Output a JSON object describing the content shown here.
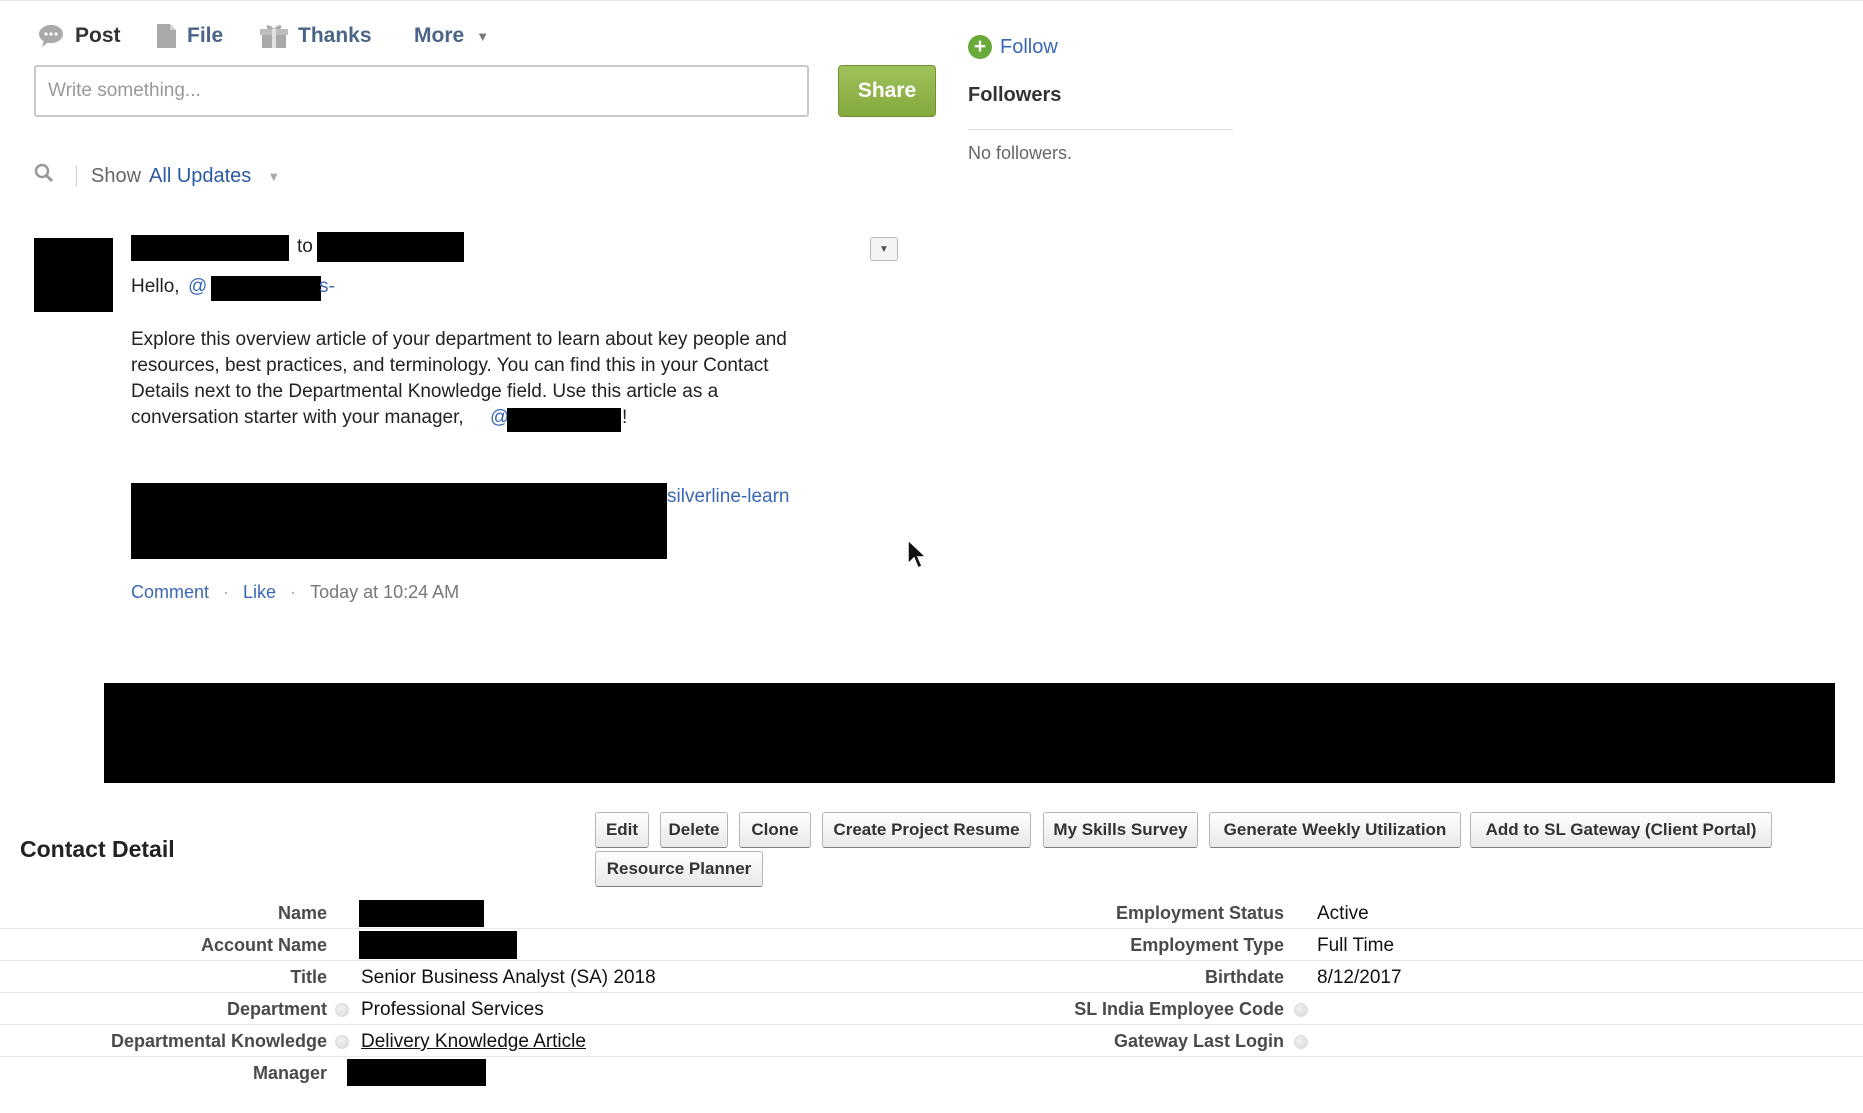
{
  "publisher": {
    "tabs": [
      {
        "label": "Post",
        "icon": "speech-bubble-icon"
      },
      {
        "label": "File",
        "icon": "file-icon"
      },
      {
        "label": "Thanks",
        "icon": "gift-icon"
      },
      {
        "label": "More",
        "icon": "chevron-down-icon"
      }
    ],
    "compose_placeholder": "Write something...",
    "share_label": "Share"
  },
  "filter": {
    "show_label": "Show",
    "selected": "All Updates"
  },
  "feed_item": {
    "to_word": "to",
    "greeting": "Hello,",
    "mention_prefix": "@",
    "mention_suffix": "s-",
    "body": "Explore this overview article of your department to learn about key people and resources, best practices, and terminology. You can find this in your Contact Details next to the Departmental Knowledge field. Use this article as a conversation starter with your manager,",
    "manager_mention_prefix": "@",
    "exclaim": "!",
    "link_text": "silverline-learn",
    "actions": {
      "comment": "Comment",
      "like": "Like",
      "time": "Today at 10:24 AM"
    }
  },
  "follow_panel": {
    "follow_label": "Follow",
    "followers_heading": "Followers",
    "no_followers": "No followers."
  },
  "contact_detail": {
    "title": "Contact Detail",
    "buttons": {
      "edit": "Edit",
      "delete": "Delete",
      "clone": "Clone",
      "create_resume": "Create Project Resume",
      "skills_survey": "My Skills Survey",
      "weekly_util": "Generate Weekly Utilization",
      "gateway": "Add to SL Gateway (Client Portal)",
      "resource_planner": "Resource Planner"
    },
    "left_fields": {
      "name": {
        "label": "Name",
        "value": ""
      },
      "account_name": {
        "label": "Account Name",
        "value": ""
      },
      "title": {
        "label": "Title",
        "value": "Senior Business Analyst (SA) 2018"
      },
      "department": {
        "label": "Department",
        "value": "Professional Services"
      },
      "dept_knowledge": {
        "label": "Departmental Knowledge",
        "value": "Delivery Knowledge Article"
      },
      "manager": {
        "label": "Manager",
        "value": ""
      }
    },
    "right_fields": {
      "employment_status": {
        "label": "Employment Status",
        "value": "Active"
      },
      "employment_type": {
        "label": "Employment Type",
        "value": "Full Time"
      },
      "birthdate": {
        "label": "Birthdate",
        "value": "8/12/2017"
      },
      "india_code": {
        "label": "SL India Employee Code",
        "value": ""
      },
      "gateway_login": {
        "label": "Gateway Last Login",
        "value": ""
      }
    }
  },
  "colors": {
    "link": "#3a68b5",
    "share_green": "#8db44a",
    "follow_green": "#6aaa3a"
  }
}
